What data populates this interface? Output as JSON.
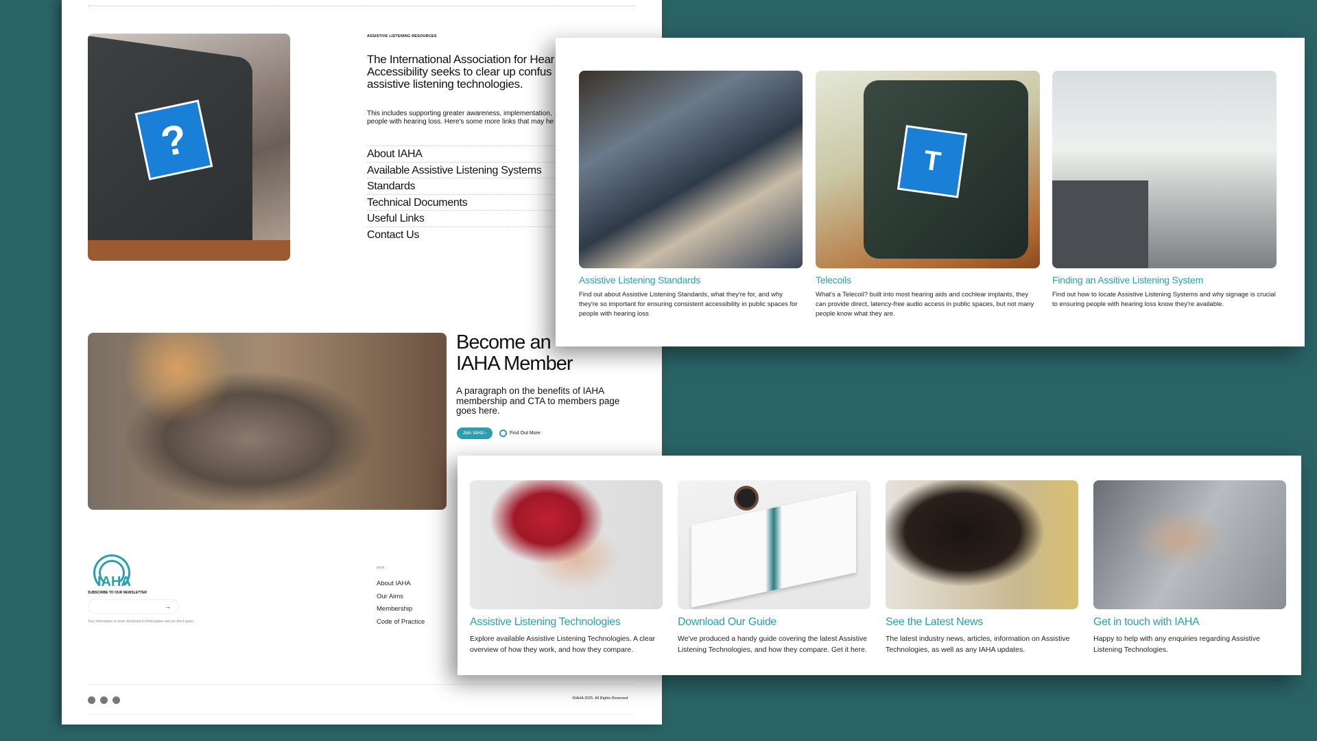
{
  "resources": {
    "eyebrow": "ASSISTIVE LISTENING RESOURCES",
    "heading": "The International Association for Hearing Accessibility seeks to clear up confusion around assistive listening technologies.",
    "heading_lines": [
      "The International Association for Hear",
      "Accessibility seeks to clear up confus",
      "assistive listening technologies."
    ],
    "intro_lines": [
      "This includes supporting greater awareness, implementation,",
      "people with hearing loss. Here's some more links that may he"
    ],
    "links": [
      "About IAHA",
      "Available Assistive Listening Systems",
      "Standards",
      "Technical Documents",
      "Useful Links",
      "Contact Us"
    ]
  },
  "member": {
    "heading_lines": [
      "Become an",
      "IAHA Member"
    ],
    "paragraph": "A paragraph on the benefits of IAHA membership and CTA to members page goes here.",
    "join_button": "Join IAHA ›",
    "find_more": "Find Out More"
  },
  "top_cards": [
    {
      "title": "Assistive Listening Standards",
      "desc": "Find out about Assistive Listening Standards, what they're for, and why they're so important for ensuring consistent accessibility in public spaces for people with hearing loss"
    },
    {
      "title": "Telecoils",
      "desc": "What's a Telecoil? built into most hearing aids and cochlear implants, they can provide direct, latency-free audio access in public spaces, but not many people know what they are."
    },
    {
      "title": "Finding an Assitive Listening System",
      "desc": "Find out how to locate Assistive Listening Systems and why signage is crucial to ensuring people with hearing loss know they're available."
    }
  ],
  "bottom_cards": [
    {
      "title": "Assistive Listening Technologies",
      "desc": "Explore available Assistive Listening Technologies. A clear overview of how they work, and how they compare."
    },
    {
      "title": "Download Our Guide",
      "desc": "We've produced a handy guide covering the latest Assistive Listening Technologies, and how they compare. Get it here."
    },
    {
      "title": "See the Latest News",
      "desc": "The latest industry news, articles, information on Assistive Technologies, as well as any IAHA updates."
    },
    {
      "title": "Get in touch with IAHA",
      "desc": "Happy to help with any enquiries regarding Assistive Listening Technologies."
    }
  ],
  "footer": {
    "logo_text": "IAHA",
    "newsletter_label": "SUBSCRIBE TO OUR NEWSLETTER",
    "newsletter_placeholder": "",
    "privacy_note": "Your information is never disclosed to third parties and we don't spam.",
    "col1_heading": "IAHA",
    "col1_links": [
      "About IAHA",
      "Our Aims",
      "Membership",
      "Code of Practice"
    ],
    "copyright": "©IAHA 2025. All Rights Reserved",
    "socials": [
      "facebook-icon",
      "youtube-icon",
      "linkedin-icon"
    ]
  },
  "colors": {
    "background": "#2a6366",
    "accent": "#2a9fae",
    "sign_blue": "#1a7fd6"
  }
}
